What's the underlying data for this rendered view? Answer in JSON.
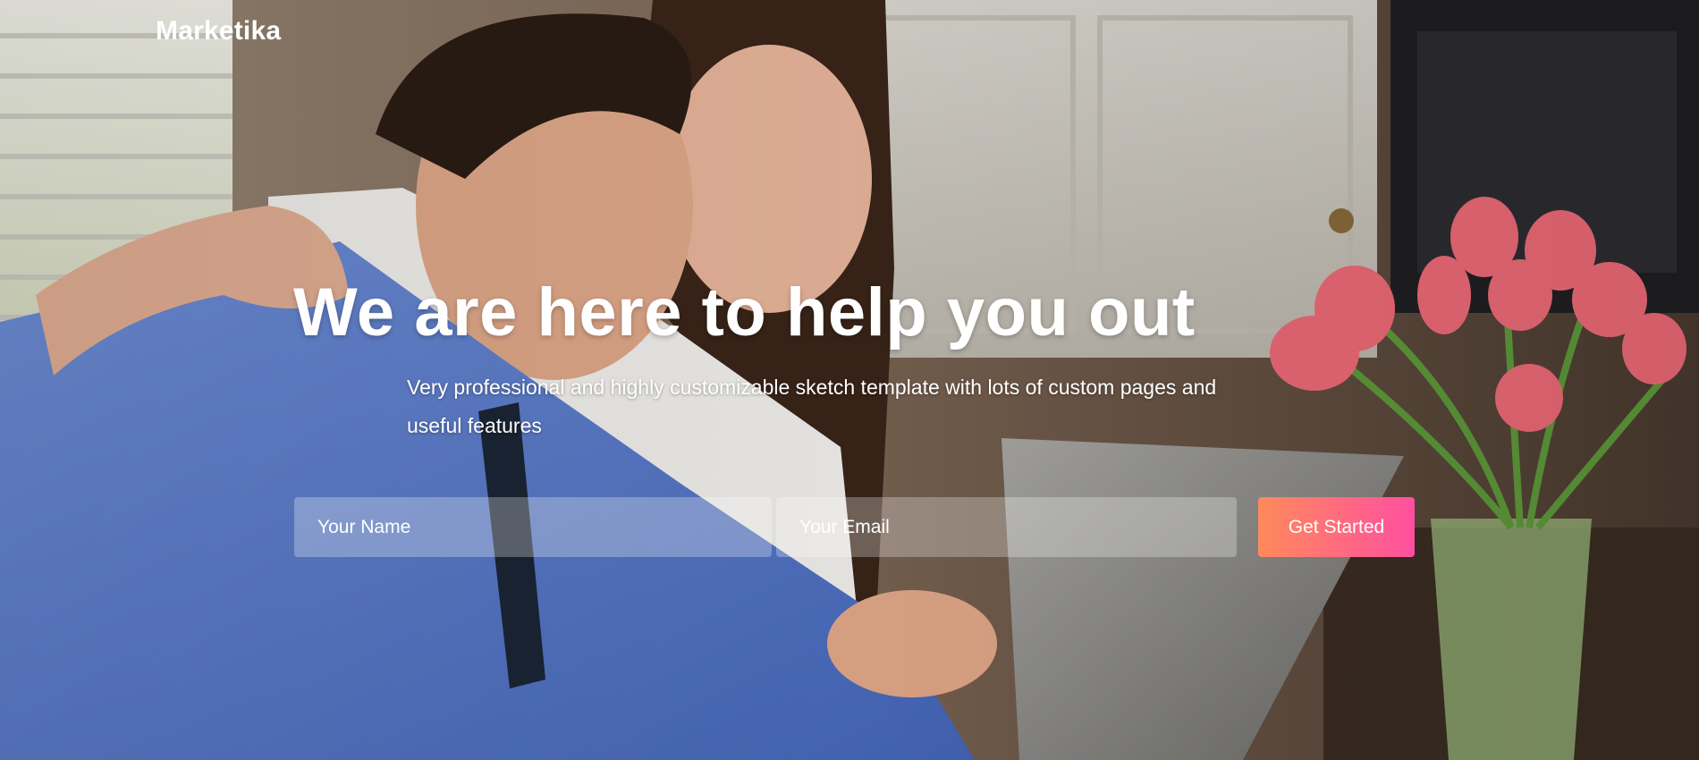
{
  "brand": {
    "name": "Marketika"
  },
  "hero": {
    "headline": "We are here to help you out",
    "subtitle": "Very professional and highly customizable sketch template with lots of custom pages and useful features"
  },
  "signup": {
    "name_placeholder": "Your Name",
    "email_placeholder": "Your Email",
    "cta_label": "Get Started"
  },
  "colors": {
    "cta_gradient_start": "#ff8a5b",
    "cta_gradient_end": "#ff4fa0",
    "text": "#ffffff"
  },
  "background": {
    "image_icon": "photo-couple-laptop-kitchen"
  }
}
